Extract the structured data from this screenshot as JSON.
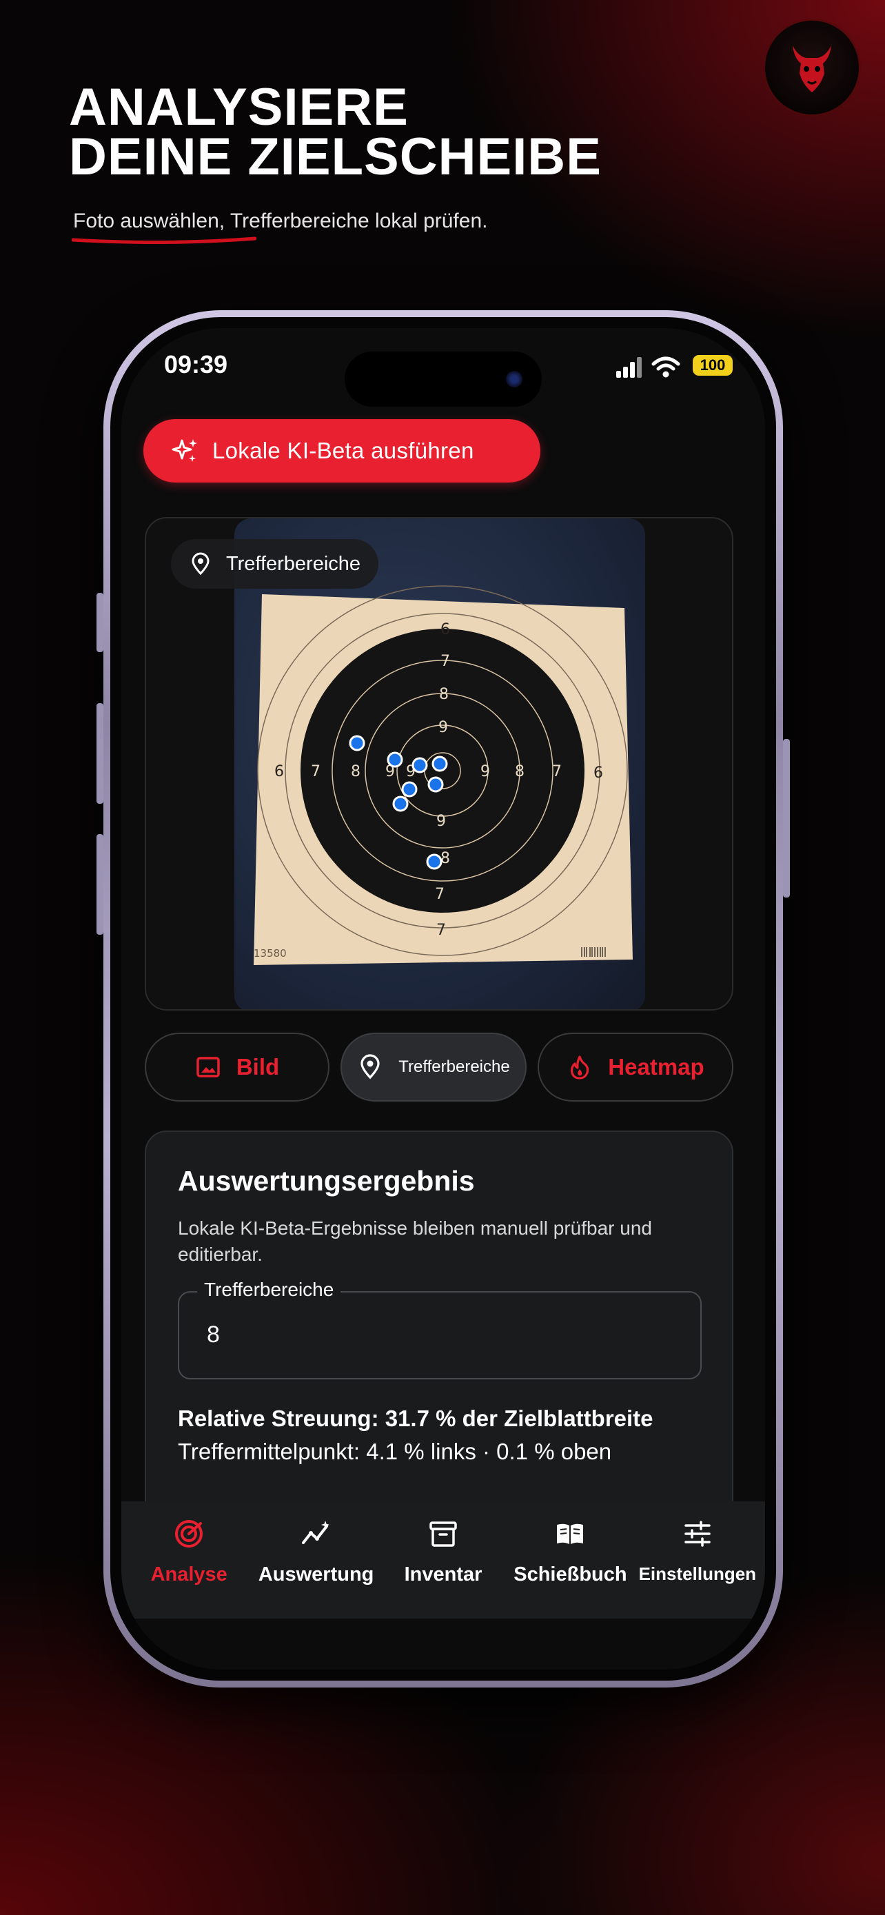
{
  "headline": {
    "line1": "ANALYSIERE",
    "line2": "DEINE ZIELSCHEIBE"
  },
  "subline": "Foto auswählen, Trefferbereiche lokal prüfen.",
  "logo_icon": "bull-head-icon",
  "status_bar": {
    "time": "09:39",
    "battery": "100"
  },
  "ki_button": {
    "label": "Lokale KI-Beta ausführen",
    "icon": "sparkles-icon"
  },
  "preview": {
    "chip_label": "Trefferbereiche",
    "chip_icon": "location-pin-icon",
    "target_serial": "13580",
    "ring_numbers": [
      "6",
      "7",
      "8",
      "9",
      "9",
      "8",
      "7",
      "6",
      "8",
      "9",
      "9",
      "7",
      "6",
      "7",
      "8",
      "9",
      "7",
      "6"
    ]
  },
  "view_toggle": {
    "image": {
      "label": "Bild",
      "icon": "image-icon"
    },
    "hits": {
      "label": "Trefferbereiche",
      "icon": "location-pin-icon"
    },
    "heatmap": {
      "label": "Heatmap",
      "icon": "flame-icon"
    },
    "selected": "Trefferbereiche"
  },
  "result": {
    "title": "Auswertungsergebnis",
    "description": "Lokale KI-Beta-Ergebnisse bleiben manuell prüfbar und editierbar.",
    "field_label": "Trefferbereiche",
    "field_value": "8",
    "spread": "Relative Streuung: 31.7 % der Zielblattbreite",
    "center": "Treffermittelpunkt: 4.1 % links · 0.1 % oben"
  },
  "tabs": [
    {
      "label": "Analyse",
      "icon": "target-icon",
      "active": true
    },
    {
      "label": "Auswertung",
      "icon": "trend-chart-icon",
      "active": false
    },
    {
      "label": "Inventar",
      "icon": "archive-box-icon",
      "active": false
    },
    {
      "label": "Schießbuch",
      "icon": "open-book-icon",
      "active": false
    },
    {
      "label": "Einstellungen",
      "icon": "sliders-icon",
      "active": false
    }
  ],
  "colors": {
    "accent": "#e8202f",
    "hit_marker": "#1a73e8",
    "battery": "#f2d01b"
  }
}
